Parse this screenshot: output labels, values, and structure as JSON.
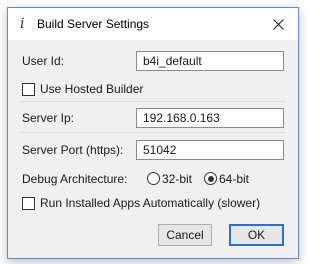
{
  "window": {
    "title": "Build Server Settings",
    "icon": "info-icon"
  },
  "form": {
    "user_id": {
      "label": "User Id:",
      "value": "b4i_default"
    },
    "use_hosted_builder": {
      "label": "Use Hosted Builder",
      "checked": false
    },
    "server_ip": {
      "label": "Server Ip:",
      "value": "192.168.0.163"
    },
    "server_port": {
      "label": "Server Port (https):",
      "value": "51042"
    },
    "debug_architecture": {
      "label": "Debug Architecture:",
      "options": [
        {
          "label": "32-bit",
          "selected": false
        },
        {
          "label": "64-bit",
          "selected": true
        }
      ]
    },
    "run_installed_apps": {
      "label": "Run Installed Apps Automatically (slower)",
      "checked": false
    }
  },
  "buttons": {
    "cancel": "Cancel",
    "ok": "OK"
  },
  "colors": {
    "window_border": "#5a8fd0",
    "default_button_border": "#2c6fd0",
    "dialog_background": "#f0f0f0"
  }
}
